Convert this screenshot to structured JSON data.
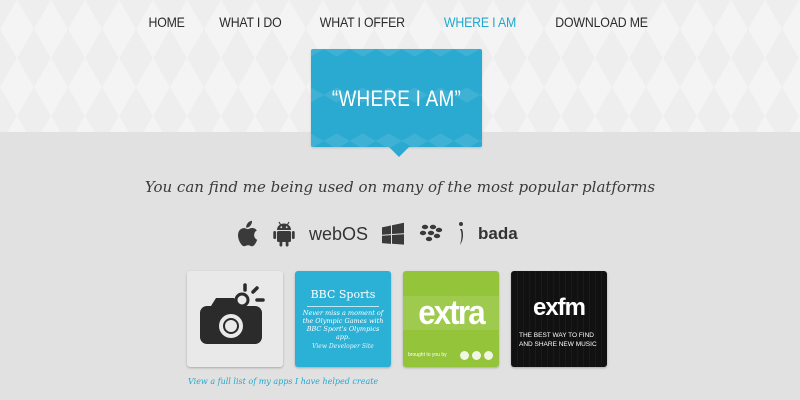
{
  "nav": {
    "items": [
      {
        "label": "HOME"
      },
      {
        "label": "WHAT I DO"
      },
      {
        "label": "WHAT I OFFER"
      },
      {
        "label": "WHERE I AM"
      },
      {
        "label": "DOWNLOAD ME"
      }
    ],
    "active_index": 3,
    "active_color": "#21a8cf"
  },
  "hero": {
    "title": "“WHERE I AM”",
    "badge_color": "#2aa9d1"
  },
  "tagline": "You can find me being used on many of the most popular platforms",
  "platforms": [
    {
      "icon": "apple-icon"
    },
    {
      "icon": "android-icon"
    },
    {
      "label": "webOS"
    },
    {
      "icon": "windows-icon"
    },
    {
      "icon": "blackberry-icon"
    },
    {
      "icon": "symbian-icon"
    },
    {
      "label": "bada"
    }
  ],
  "apps": [
    {
      "name": "camera-app",
      "icon": "camera-icon"
    },
    {
      "name": "bbc-sports",
      "title": "BBC Sports",
      "desc": "Never miss a moment of the Olympic Games with BBC Sport's Olympics app.",
      "link": "View Developer Site"
    },
    {
      "name": "extra",
      "word": "extra",
      "byline": "brought to you by"
    },
    {
      "name": "exfm",
      "logo_ex": "ex",
      "logo_fm": "fm",
      "tagline": "THE BEST WAY TO FIND AND SHARE NEW MUSIC"
    }
  ],
  "apps_link": "View a full list of my apps I have helped create"
}
